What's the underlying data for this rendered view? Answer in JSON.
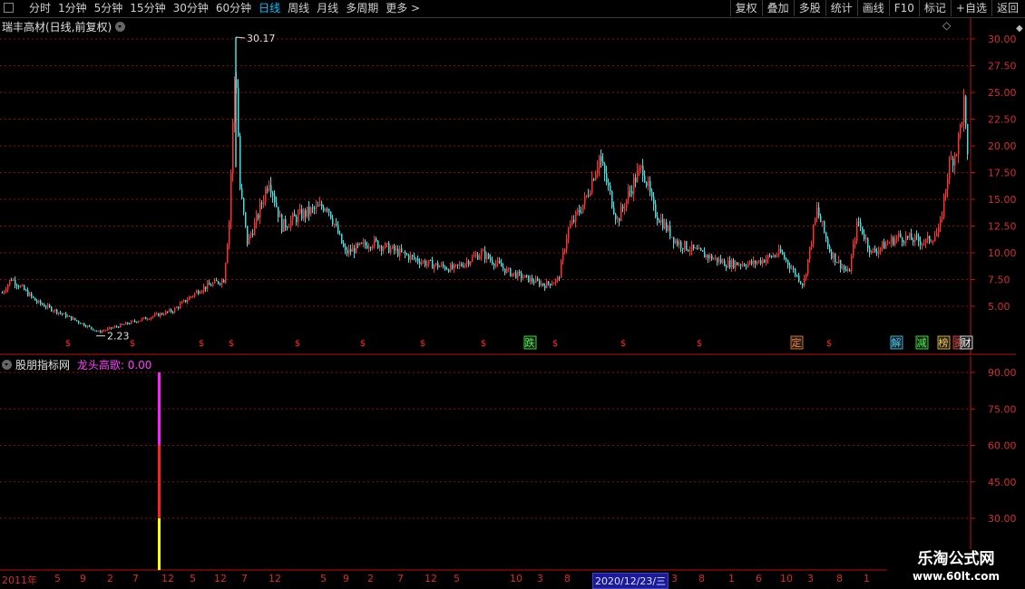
{
  "toolbar": {
    "period_tabs": [
      "分时",
      "1分钟",
      "5分钟",
      "15分钟",
      "30分钟",
      "60分钟",
      "日线",
      "周线",
      "月线",
      "多周期",
      "更多"
    ],
    "active_tab": "日线",
    "more_arrow": ">",
    "right_buttons": [
      "复权",
      "叠加",
      "多股",
      "统计",
      "画线",
      "F10",
      "标记",
      "+自选",
      "返回"
    ]
  },
  "main_panel": {
    "title": "瑞丰高材(日线,前复权)",
    "diamond": "◇",
    "y_ticks": [
      "30.00",
      "27.50",
      "25.00",
      "22.50",
      "20.00",
      "17.50",
      "15.00",
      "12.50",
      "10.00",
      "7.50",
      "5.00"
    ],
    "max_label": "30.17",
    "min_label": "2.23",
    "event_markers": [
      {
        "text": "$",
        "color": "#ff3030"
      },
      {
        "text": "$",
        "color": "#ff3030"
      },
      {
        "text": "$",
        "color": "#ff3030"
      },
      {
        "text": "$",
        "color": "#ff3030"
      },
      {
        "text": "$",
        "color": "#ff3030"
      },
      {
        "text": "$",
        "color": "#ff3030"
      },
      {
        "text": "$",
        "color": "#ff3030"
      },
      {
        "text": "$",
        "color": "#ff3030"
      },
      {
        "text": "跌",
        "color": "#40ff40",
        "boxed": true
      },
      {
        "text": "$",
        "color": "#ff3030"
      },
      {
        "text": "$",
        "color": "#ff3030"
      },
      {
        "text": "$",
        "color": "#ff3030"
      },
      {
        "text": "定",
        "color": "#ff8030",
        "boxed": true
      },
      {
        "text": "$",
        "color": "#ff3030"
      },
      {
        "text": "解",
        "color": "#40d0ff",
        "boxed": true
      },
      {
        "text": "减",
        "color": "#40ff40",
        "boxed": true
      },
      {
        "text": "榜",
        "color": "#ffd040",
        "boxed": true
      },
      {
        "text": "资",
        "color": "#ff4040",
        "boxed": true
      },
      {
        "text": "财",
        "color": "#ffffff",
        "boxed": true
      }
    ]
  },
  "indicator_panel": {
    "title": "股朋指标网",
    "formula": "龙头高歌: 0.00",
    "y_ticks": [
      "90.00",
      "75.00",
      "60.00",
      "45.00",
      "30.00"
    ],
    "bar": {
      "segments": [
        {
          "from": 9,
          "to": 30,
          "color": "#ffff00"
        },
        {
          "from": 30,
          "to": 60,
          "color": "#ff2020"
        },
        {
          "from": 60,
          "to": 90,
          "color": "#ff20ff"
        }
      ]
    }
  },
  "date_axis": {
    "labels": [
      "2011年",
      "5",
      "9",
      "2",
      "7",
      "12",
      "5",
      "12",
      "7",
      "12",
      "5",
      "9",
      "2",
      "7",
      "12",
      "5",
      "10",
      "3",
      "8",
      "2020/12/23/三",
      "3",
      "8",
      "1",
      "6",
      "10",
      "3",
      "8",
      "1"
    ],
    "highlight": "2020/12/23/三"
  },
  "watermark": {
    "line1": "乐淘公式网",
    "line2": "www.60lt.com"
  },
  "colors": {
    "up": "#ff3030",
    "down": "#40e0e0",
    "grid": "#8b1010",
    "axis": "#c01010"
  }
}
